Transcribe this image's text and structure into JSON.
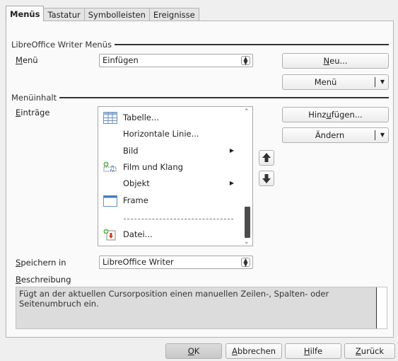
{
  "tabs": [
    "Menüs",
    "Tastatur",
    "Symbolleisten",
    "Ereignisse"
  ],
  "section1": {
    "title": "LibreOffice Writer Menüs",
    "menu_label_u": "M",
    "menu_label_rest": "enü",
    "menu_value": "Einfügen",
    "new_button_u": "N",
    "new_button_rest": "eu...",
    "menu_button": "Menü"
  },
  "section2": {
    "title": "Menüinhalt",
    "entries_label_u": "E",
    "entries_label_rest": "inträge",
    "items": [
      {
        "label": "Tabelle...",
        "icon": "table-icon",
        "submenu": false
      },
      {
        "label": "Horizontale Linie...",
        "icon": "",
        "submenu": false
      },
      {
        "label": "Bild",
        "icon": "",
        "submenu": true
      },
      {
        "label": "Film und Klang",
        "icon": "media-icon",
        "submenu": false
      },
      {
        "label": "Objekt",
        "icon": "",
        "submenu": true
      },
      {
        "label": "Frame",
        "icon": "frame-icon",
        "submenu": false
      },
      {
        "label": "Datei...",
        "icon": "insert-file-icon",
        "submenu": false
      }
    ],
    "add_button_pre": "Hinz",
    "add_button_u": "u",
    "add_button_post": "fügen...",
    "change_button": "Ändern",
    "save_in_label_u": "S",
    "save_in_label_rest": "peichern in",
    "save_in_value": "LibreOffice Writer"
  },
  "description": {
    "label_u": "B",
    "label_rest": "eschreibung",
    "text": "Fügt an der aktuellen Cursorposition einen manuellen Zeilen-, Spalten- oder Seitenumbruch ein."
  },
  "footer": {
    "ok_u": "O",
    "ok_rest": "K",
    "cancel_u": "A",
    "cancel_rest": "bbrechen",
    "help_u": "H",
    "help_rest": "ilfe",
    "back_u": "Z",
    "back_rest": "urück"
  }
}
